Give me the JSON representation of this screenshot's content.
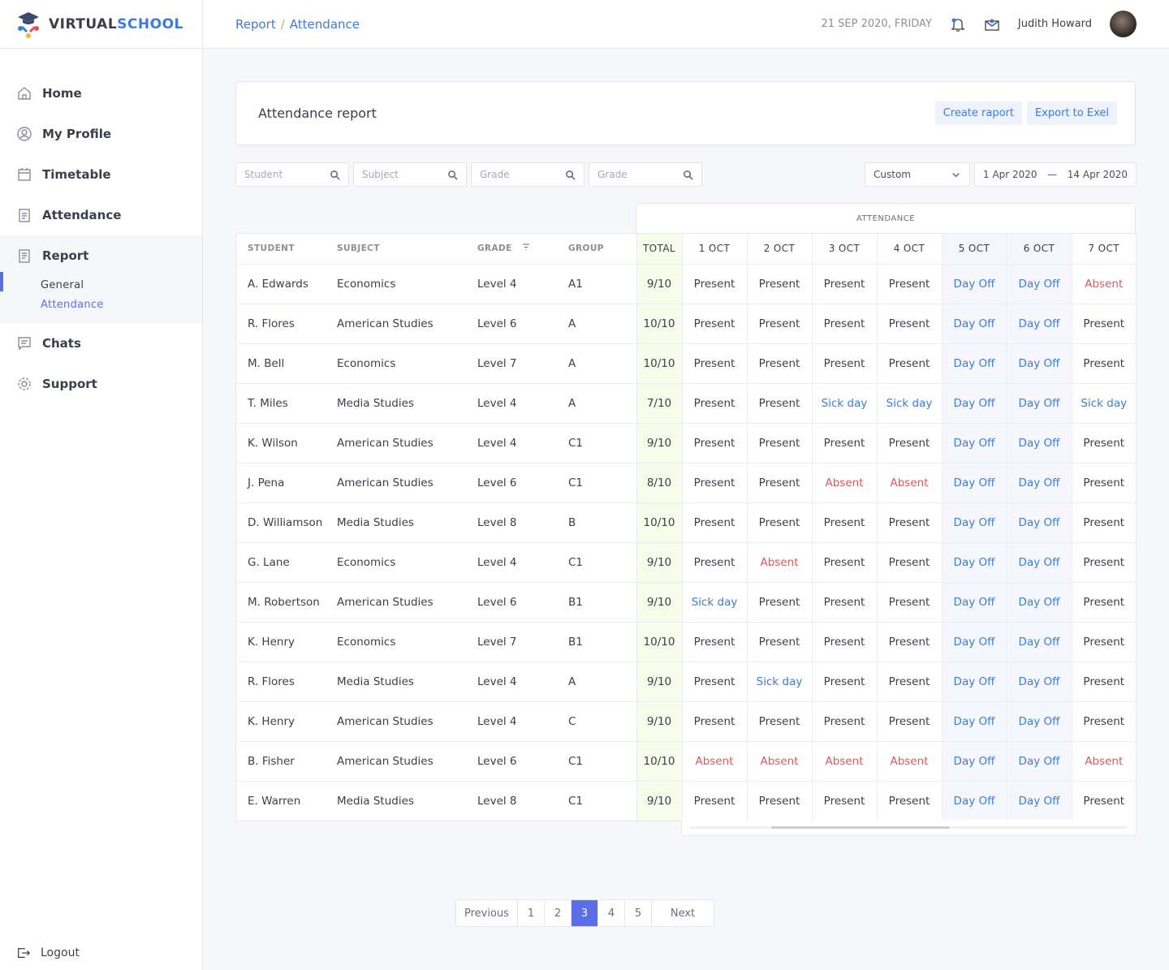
{
  "brand": {
    "part1": "VIRTUAL",
    "part2": "SCHOOL"
  },
  "sidebar": {
    "items": [
      {
        "label": "Home",
        "icon": "home-icon"
      },
      {
        "label": "My Profile",
        "icon": "user-circle-icon"
      },
      {
        "label": "Timetable",
        "icon": "calendar-icon"
      },
      {
        "label": "Attendance",
        "icon": "clipboard-icon"
      }
    ],
    "report": {
      "label": "Report",
      "sub": [
        "General",
        "Attendance"
      ]
    },
    "items2": [
      {
        "label": "Chats",
        "icon": "chat-icon"
      },
      {
        "label": "Support",
        "icon": "gear-icon"
      }
    ],
    "logout": "Logout"
  },
  "header": {
    "breadcrumb": [
      "Report",
      "Attendance"
    ],
    "date": "21 SEP 2020, FRIDAY",
    "user": "Judith Howard"
  },
  "card": {
    "title": "Attendance report",
    "create": "Create raport",
    "export": "Export to Exel"
  },
  "filters": {
    "student": "Student",
    "subject": "Subject",
    "grade1": "Grade",
    "grade2": "Grade",
    "range": "Custom",
    "from": "1 Apr 2020",
    "to": "14 Apr 2020"
  },
  "table": {
    "group_header": "ATTENDANCE",
    "columns": [
      "STUDENT",
      "SUBJECT",
      "GRADE",
      "GROUP",
      "TOTAL",
      "1 OCT",
      "2 OCT",
      "3 OCT",
      "4 OCT",
      "5 OCT",
      "6 OCT",
      "7 OCT"
    ],
    "rows": [
      [
        "A. Edwards",
        "Economics",
        "Level 4",
        "A1",
        "9/10",
        "Present",
        "Present",
        "Present",
        "Present",
        "Day Off",
        "Day Off",
        "Absent"
      ],
      [
        "R. Flores",
        "American Studies",
        "Level 6",
        "A",
        "10/10",
        "Present",
        "Present",
        "Present",
        "Present",
        "Day Off",
        "Day Off",
        "Present"
      ],
      [
        "M. Bell",
        "Economics",
        "Level 7",
        "A",
        "10/10",
        "Present",
        "Present",
        "Present",
        "Present",
        "Day Off",
        "Day Off",
        "Present"
      ],
      [
        "T. Miles",
        "Media Studies",
        "Level 4",
        "A",
        "7/10",
        "Present",
        "Present",
        "Sick day",
        "Sick day",
        "Day Off",
        "Day Off",
        "Sick day"
      ],
      [
        "K. Wilson",
        "American Studies",
        "Level 4",
        "C1",
        "9/10",
        "Present",
        "Present",
        "Present",
        "Present",
        "Day Off",
        "Day Off",
        "Present"
      ],
      [
        "J. Pena",
        "American Studies",
        "Level 6",
        "C1",
        "8/10",
        "Present",
        "Present",
        "Absent",
        "Absent",
        "Day Off",
        "Day Off",
        "Present"
      ],
      [
        "D. Williamson",
        "Media Studies",
        "Level 8",
        "B",
        "10/10",
        "Present",
        "Present",
        "Present",
        "Present",
        "Day Off",
        "Day Off",
        "Present"
      ],
      [
        "G. Lane",
        "Economics",
        "Level 4",
        "C1",
        "9/10",
        "Present",
        "Absent",
        "Present",
        "Present",
        "Day Off",
        "Day Off",
        "Present"
      ],
      [
        "M. Robertson",
        "American Studies",
        "Level 6",
        "B1",
        "9/10",
        "Sick day",
        "Present",
        "Present",
        "Present",
        "Day Off",
        "Day Off",
        "Present"
      ],
      [
        "K. Henry",
        "Economics",
        "Level 7",
        "B1",
        "10/10",
        "Present",
        "Present",
        "Present",
        "Present",
        "Day Off",
        "Day Off",
        "Present"
      ],
      [
        "R. Flores",
        "Media Studies",
        "Level 4",
        "A",
        "9/10",
        "Present",
        "Sick day",
        "Present",
        "Present",
        "Day Off",
        "Day Off",
        "Present"
      ],
      [
        "K. Henry",
        "American Studies",
        "Level 4",
        "C",
        "9/10",
        "Present",
        "Present",
        "Present",
        "Present",
        "Day Off",
        "Day Off",
        "Present"
      ],
      [
        "B. Fisher",
        "American Studies",
        "Level 6",
        "C1",
        "10/10",
        "Absent",
        "Absent",
        "Absent",
        "Absent",
        "Day Off",
        "Day Off",
        "Absent"
      ],
      [
        "E. Warren",
        "Media Studies",
        "Level 8",
        "C1",
        "9/10",
        "Present",
        "Present",
        "Present",
        "Present",
        "Day Off",
        "Day Off",
        "Present"
      ]
    ]
  },
  "pagination": {
    "prev": "Previous",
    "pages": [
      "1",
      "2",
      "3",
      "4",
      "5"
    ],
    "current": "3",
    "next": "Next"
  },
  "colors": {
    "accent": "#5a6ee8",
    "link": "#3d7bd8",
    "absent": "#e05656",
    "total_bg": "#f6fbea"
  }
}
